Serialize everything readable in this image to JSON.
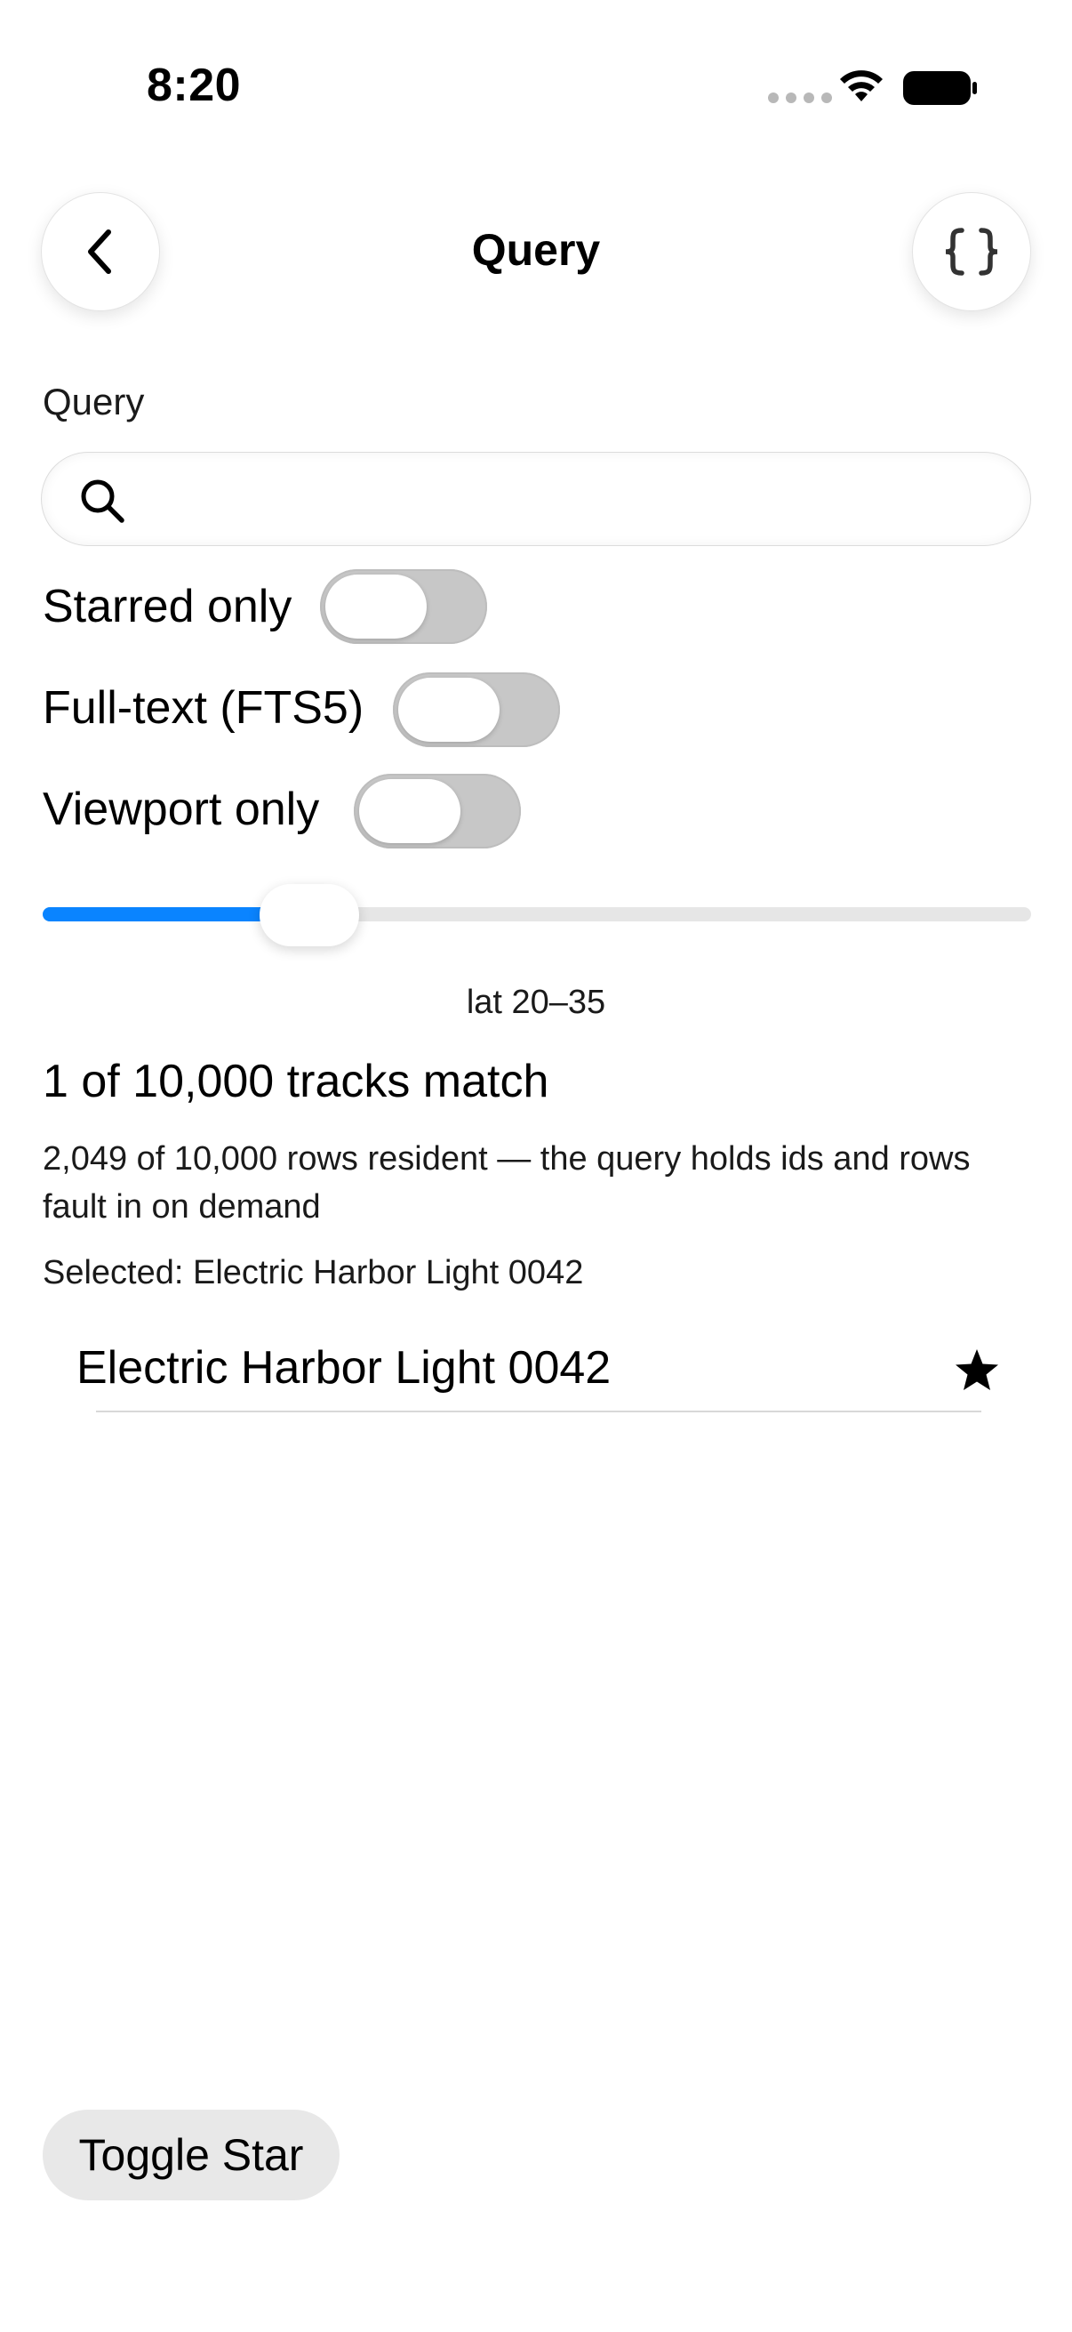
{
  "status_bar": {
    "time": "8:20"
  },
  "nav": {
    "title": "Query"
  },
  "search": {
    "label": "Query",
    "value": "",
    "placeholder": ""
  },
  "toggles": [
    {
      "label": "Starred only",
      "on": false
    },
    {
      "label": "Full-text (FTS5)",
      "on": false
    },
    {
      "label": "Viewport only",
      "on": false
    }
  ],
  "slider": {
    "fraction": 0.27,
    "caption": "lat 20–35"
  },
  "results": {
    "match_count": "1 of 10,000 tracks match",
    "resident_text": "2,049 of 10,000 rows resident — the query holds ids and rows fault in on demand",
    "selected_text": "Selected: Electric Harbor Light 0042",
    "items": [
      {
        "title": "Electric Harbor Light 0042",
        "starred": true
      }
    ]
  },
  "actions": {
    "toggle_star_label": "Toggle Star"
  },
  "colors": {
    "accent": "#0a84ff",
    "toggle_off": "#c7c7c7"
  }
}
